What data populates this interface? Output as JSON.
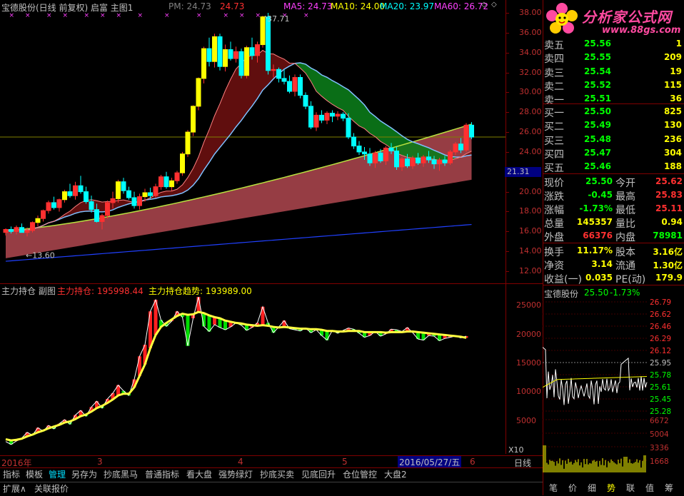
{
  "main_chart": {
    "title": "宝德股份(日线 前复权) 启富 主图1",
    "pm_label": "PM: 24.73",
    "pm_value": "24.73",
    "ma5": "MA5: 24.73",
    "ma10": "MA10: 24.00",
    "ma20": "MA20: 23.97",
    "ma60": "MA60: 26.72",
    "high_annotation": "37.71",
    "low_annotation": "←13.60",
    "y_ticks": [
      "38.00",
      "36.00",
      "34.00",
      "32.00",
      "30.00",
      "28.00",
      "26.00",
      "24.00",
      "22.00",
      "20.00",
      "18.00",
      "16.00",
      "14.00",
      "12.00"
    ],
    "current_price_tag": "21.31",
    "colors": {
      "up": "#ff3030",
      "down": "#00ffff",
      "yellow": "#ffff00",
      "ma60_band": "#b04850",
      "ma_fill_red": "#6a1010",
      "ma_fill_green": "#0b7a1a"
    }
  },
  "sub_chart": {
    "title": "主力持仓 副图",
    "holding_label": "主力持仓: 195998.44",
    "trend_label": "主力持仓趋势: 193989.00",
    "y_ticks": [
      "25000",
      "20000",
      "15000",
      "10000",
      "5000"
    ],
    "x10_label": "X10"
  },
  "x_axis": {
    "labels": [
      "2016年",
      "3",
      "4",
      "5",
      "6"
    ],
    "cursor_date": "2016/05/27/五",
    "period": "日线"
  },
  "tabs": [
    "指标",
    "模板",
    "管理",
    "另存为",
    "抄底黑马",
    "普通指标",
    "看大盘",
    "强势绿灯",
    "抄底买卖",
    "见底回升",
    "仓位管控",
    "大盘2"
  ],
  "active_tab": "管理",
  "bottom_tabs": [
    "扩展∧",
    "关联报价"
  ],
  "logo": {
    "text": "分析家公式网",
    "url": "www.88gs.com"
  },
  "order_book": {
    "sell": [
      {
        "label": "卖五",
        "price": "25.56",
        "vol": "1"
      },
      {
        "label": "卖四",
        "price": "25.55",
        "vol": "209"
      },
      {
        "label": "卖三",
        "price": "25.54",
        "vol": "19"
      },
      {
        "label": "卖二",
        "price": "25.52",
        "vol": "115"
      },
      {
        "label": "卖一",
        "price": "25.51",
        "vol": "36"
      }
    ],
    "buy": [
      {
        "label": "买一",
        "price": "25.50",
        "vol": "825"
      },
      {
        "label": "买二",
        "price": "25.49",
        "vol": "130"
      },
      {
        "label": "买三",
        "price": "25.48",
        "vol": "236"
      },
      {
        "label": "买四",
        "price": "25.47",
        "vol": "304"
      },
      {
        "label": "买五",
        "price": "25.46",
        "vol": "188"
      }
    ]
  },
  "quote": {
    "rows": [
      {
        "l1": "现价",
        "v1": "25.50",
        "l2": "今开",
        "v2": "25.62"
      },
      {
        "l1": "涨跌",
        "v1": "-0.45",
        "l2": "最高",
        "v2": "25.83"
      },
      {
        "l1": "涨幅",
        "v1": "-1.73%",
        "l2": "最低",
        "v2": "25.11"
      },
      {
        "l1": "总量",
        "v1": "145357",
        "l2": "量比",
        "v2": "0.94"
      },
      {
        "l1": "外盘",
        "v1": "66376",
        "l2": "内盘",
        "v2": "78981"
      }
    ],
    "rows2": [
      {
        "l1": "换手",
        "v1": "11.17%",
        "l2": "股本",
        "v2": "3.16亿"
      },
      {
        "l1": "净资",
        "v1": "3.14",
        "l2": "流通",
        "v2": "1.30亿"
      },
      {
        "l1": "收益(一)",
        "v1": "0.035",
        "l2": "PE(动)",
        "v2": "179.9"
      }
    ]
  },
  "mini_chart": {
    "name": "宝德股份",
    "price": "25.50",
    "change": "-1.73%",
    "price_ticks": [
      "26.79",
      "26.62",
      "26.46",
      "26.29",
      "26.12",
      "25.95",
      "25.78",
      "25.61",
      "25.45",
      "25.28"
    ],
    "vol_ticks": [
      "6672",
      "5004",
      "3336",
      "1668"
    ]
  },
  "right_bottom_tabs": [
    "笔",
    "价",
    "细",
    "势",
    "联",
    "值",
    "筹"
  ],
  "right_bottom_active": "势",
  "candles": [
    [
      15.9,
      16.3,
      15.6,
      16.2
    ],
    [
      16.2,
      16.5,
      15.8,
      16.0
    ],
    [
      16.0,
      16.6,
      15.7,
      16.4
    ],
    [
      16.4,
      16.8,
      16.0,
      15.9
    ],
    [
      15.9,
      16.4,
      15.5,
      16.1
    ],
    [
      16.1,
      17.0,
      15.9,
      16.9
    ],
    [
      16.9,
      17.6,
      16.5,
      17.3
    ],
    [
      17.3,
      18.2,
      17.0,
      18.1
    ],
    [
      18.1,
      19.1,
      17.8,
      18.9
    ],
    [
      18.9,
      19.5,
      18.2,
      18.4
    ],
    [
      18.4,
      19.3,
      18.0,
      19.2
    ],
    [
      19.2,
      20.2,
      18.9,
      20.0
    ],
    [
      20.0,
      20.8,
      19.4,
      19.6
    ],
    [
      19.6,
      21.0,
      19.2,
      20.6
    ],
    [
      20.6,
      21.6,
      19.8,
      20.0
    ],
    [
      20.0,
      20.5,
      18.8,
      19.0
    ],
    [
      19.0,
      19.6,
      17.9,
      18.2
    ],
    [
      18.2,
      18.8,
      16.9,
      17.0
    ],
    [
      17.0,
      17.8,
      16.2,
      17.6
    ],
    [
      17.6,
      19.1,
      17.3,
      18.9
    ],
    [
      18.9,
      20.0,
      18.3,
      19.3
    ],
    [
      19.3,
      21.2,
      18.9,
      21.0
    ],
    [
      21.0,
      21.4,
      19.8,
      20.1
    ],
    [
      20.1,
      20.5,
      19.2,
      19.4
    ],
    [
      19.4,
      20.0,
      18.3,
      18.6
    ],
    [
      18.6,
      19.8,
      18.2,
      19.5
    ],
    [
      19.5,
      20.3,
      19.0,
      19.9
    ],
    [
      19.9,
      20.4,
      19.3,
      19.6
    ],
    [
      19.6,
      20.8,
      19.4,
      20.5
    ],
    [
      20.5,
      21.7,
      20.2,
      21.5
    ],
    [
      21.5,
      22.0,
      20.3,
      20.5
    ],
    [
      20.5,
      21.4,
      20.1,
      21.1
    ],
    [
      21.1,
      22.1,
      20.8,
      21.9
    ],
    [
      21.9,
      24.0,
      21.6,
      23.8
    ],
    [
      23.8,
      26.2,
      23.5,
      26.0
    ],
    [
      26.0,
      28.7,
      25.6,
      28.6
    ],
    [
      28.6,
      31.5,
      28.2,
      31.4
    ],
    [
      31.4,
      34.6,
      30.9,
      34.4
    ],
    [
      34.4,
      35.5,
      32.6,
      33.1
    ],
    [
      33.1,
      35.9,
      32.5,
      35.6
    ],
    [
      35.6,
      35.9,
      32.2,
      32.6
    ],
    [
      32.6,
      34.8,
      32.1,
      34.3
    ],
    [
      34.3,
      35.1,
      33.2,
      33.4
    ],
    [
      33.4,
      34.6,
      33.0,
      34.1
    ],
    [
      34.1,
      34.4,
      31.4,
      31.7
    ],
    [
      31.7,
      34.7,
      31.4,
      34.5
    ],
    [
      34.5,
      35.5,
      33.3,
      33.7
    ],
    [
      33.7,
      35.1,
      33.0,
      34.8
    ],
    [
      34.8,
      37.71,
      34.5,
      37.6
    ],
    [
      37.6,
      38.0,
      31.8,
      32.2
    ],
    [
      32.2,
      32.8,
      31.5,
      32.3
    ],
    [
      32.3,
      32.5,
      31.0,
      31.4
    ],
    [
      31.4,
      32.3,
      30.8,
      31.1
    ],
    [
      31.1,
      31.7,
      29.9,
      30.1
    ],
    [
      30.1,
      31.8,
      29.6,
      31.5
    ],
    [
      31.5,
      31.8,
      29.4,
      29.7
    ],
    [
      29.7,
      30.0,
      28.3,
      28.6
    ],
    [
      28.6,
      29.1,
      26.3,
      26.5
    ],
    [
      26.5,
      28.0,
      26.1,
      27.7
    ],
    [
      27.7,
      28.2,
      26.9,
      27.2
    ],
    [
      27.2,
      28.1,
      26.8,
      27.9
    ],
    [
      27.9,
      28.2,
      27.0,
      27.6
    ],
    [
      27.6,
      28.1,
      27.2,
      27.8
    ],
    [
      27.8,
      28.0,
      27.1,
      27.4
    ],
    [
      27.4,
      27.9,
      25.3,
      25.5
    ],
    [
      25.5,
      25.9,
      24.3,
      24.6
    ],
    [
      24.6,
      25.1,
      23.7,
      24.0
    ],
    [
      24.0,
      24.5,
      23.2,
      23.8
    ],
    [
      23.8,
      24.4,
      22.6,
      22.9
    ],
    [
      22.9,
      24.1,
      22.4,
      23.9
    ],
    [
      23.9,
      24.3,
      22.9,
      23.1
    ],
    [
      23.1,
      24.6,
      22.7,
      24.4
    ],
    [
      24.4,
      24.9,
      23.8,
      24.1
    ],
    [
      24.1,
      24.5,
      22.2,
      22.5
    ],
    [
      22.5,
      23.5,
      22.1,
      23.3
    ],
    [
      23.3,
      23.8,
      22.4,
      22.6
    ],
    [
      22.6,
      23.6,
      22.3,
      23.4
    ],
    [
      23.4,
      23.9,
      22.7,
      22.9
    ],
    [
      22.9,
      23.7,
      22.5,
      23.5
    ],
    [
      23.5,
      24.1,
      22.9,
      23.2
    ],
    [
      23.2,
      23.6,
      22.3,
      22.8
    ],
    [
      22.8,
      23.4,
      22.1,
      23.2
    ],
    [
      23.2,
      23.6,
      22.6,
      22.9
    ],
    [
      22.9,
      24.2,
      22.7,
      24.0
    ],
    [
      24.0,
      25.0,
      23.7,
      24.8
    ],
    [
      24.8,
      25.4,
      23.9,
      24.2
    ],
    [
      24.2,
      26.9,
      24.0,
      26.7
    ],
    [
      26.7,
      27.0,
      25.3,
      25.5
    ]
  ],
  "holdings": [
    [
      1400,
      1800
    ],
    [
      900,
      1600
    ],
    [
      1500,
      1700
    ],
    [
      2000,
      1900
    ],
    [
      3000,
      2300
    ],
    [
      2500,
      2600
    ],
    [
      3800,
      3000
    ],
    [
      3200,
      3300
    ],
    [
      4200,
      3700
    ],
    [
      3600,
      4000
    ],
    [
      4500,
      4300
    ],
    [
      5200,
      4700
    ],
    [
      4400,
      4900
    ],
    [
      6000,
      5300
    ],
    [
      6800,
      5800
    ],
    [
      5800,
      6100
    ],
    [
      7400,
      6600
    ],
    [
      8400,
      7200
    ],
    [
      7200,
      7600
    ],
    [
      8800,
      8100
    ],
    [
      9800,
      8700
    ],
    [
      11200,
      9400
    ],
    [
      10200,
      9700
    ],
    [
      9400,
      9700
    ],
    [
      12200,
      10800
    ],
    [
      16200,
      12800
    ],
    [
      18200,
      14800
    ],
    [
      24000,
      17600
    ],
    [
      26000,
      19900
    ],
    [
      22500,
      21300
    ],
    [
      21400,
      22000
    ],
    [
      22300,
      22600
    ],
    [
      24000,
      23200
    ],
    [
      23000,
      23600
    ],
    [
      18000,
      23400
    ],
    [
      22800,
      23500
    ],
    [
      26500,
      23900
    ],
    [
      21400,
      23700
    ],
    [
      20500,
      23300
    ],
    [
      21700,
      23000
    ],
    [
      21200,
      22800
    ],
    [
      20800,
      22400
    ],
    [
      21300,
      22200
    ],
    [
      22000,
      22000
    ],
    [
      21600,
      21900
    ],
    [
      20700,
      21700
    ],
    [
      21200,
      21600
    ],
    [
      22000,
      21500
    ],
    [
      24800,
      21600
    ],
    [
      22000,
      21500
    ],
    [
      20300,
      21300
    ],
    [
      21300,
      21200
    ],
    [
      22400,
      21300
    ],
    [
      21000,
      21200
    ],
    [
      20800,
      21100
    ],
    [
      20600,
      21000
    ],
    [
      21100,
      21000
    ],
    [
      20300,
      20900
    ],
    [
      20800,
      20900
    ],
    [
      19800,
      20800
    ],
    [
      19000,
      20600
    ],
    [
      20700,
      20600
    ],
    [
      20200,
      20500
    ],
    [
      20700,
      20500
    ],
    [
      21100,
      20600
    ],
    [
      20900,
      20600
    ],
    [
      20200,
      20600
    ],
    [
      19500,
      20400
    ],
    [
      19800,
      20400
    ],
    [
      20500,
      20400
    ],
    [
      19700,
      20400
    ],
    [
      20100,
      20300
    ],
    [
      20900,
      20400
    ],
    [
      20800,
      20400
    ],
    [
      20500,
      20400
    ],
    [
      21200,
      20500
    ],
    [
      20300,
      20500
    ],
    [
      19200,
      20400
    ],
    [
      19000,
      20300
    ],
    [
      19800,
      20200
    ],
    [
      19700,
      20100
    ],
    [
      18900,
      20000
    ],
    [
      19300,
      19900
    ],
    [
      19500,
      19800
    ],
    [
      19700,
      19700
    ],
    [
      19400,
      19600
    ],
    [
      19700,
      19400
    ]
  ]
}
